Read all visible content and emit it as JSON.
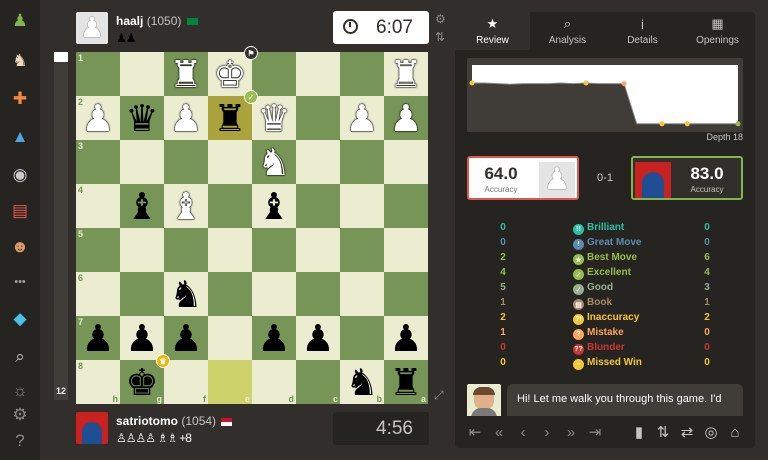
{
  "sidebar": {
    "items": [
      {
        "name": "chess-logo-icon",
        "glyph": "♟",
        "color": "#81b64c"
      },
      {
        "name": "play-icon",
        "glyph": "♞",
        "color": "#f0d9b5"
      },
      {
        "name": "puzzles-icon",
        "glyph": "✚",
        "color": "#f18a3b"
      },
      {
        "name": "learn-icon",
        "glyph": "▲",
        "color": "#4fa3e0"
      },
      {
        "name": "watch-icon",
        "glyph": "◉",
        "color": "#c9c9c9"
      },
      {
        "name": "news-icon",
        "glyph": "▤",
        "color": "#e0574f"
      },
      {
        "name": "social-icon",
        "glyph": "☻",
        "color": "#e09b6a"
      },
      {
        "name": "more-icon",
        "glyph": "•••",
        "color": "#9e9e9e"
      },
      {
        "name": "premium-diamond-icon",
        "glyph": "◆",
        "color": "#48c2e8"
      },
      {
        "name": "search-icon",
        "glyph": "⌕",
        "color": "#c6c4c2"
      },
      {
        "name": "theme-icon",
        "glyph": "☼",
        "color": "#8b8987"
      },
      {
        "name": "settings-gear-icon",
        "glyph": "⚙",
        "color": "#8b8987"
      },
      {
        "name": "help-icon",
        "glyph": "?",
        "color": "#8b8987"
      }
    ]
  },
  "top_player": {
    "name": "haalj",
    "rating": "(1050)",
    "flag": "Saudi Arabia",
    "flag_color": "#00853f",
    "captured": "♟♟"
  },
  "bottom_player": {
    "name": "satriotomo",
    "rating": "(1054)",
    "flag": "Indonesia",
    "captured": "♙♙♙♙ ♗♗ +8"
  },
  "top_clock": "6:07",
  "bottom_clock": "4:56",
  "eval_bar": {
    "value": "12",
    "white_fraction": 0.03
  },
  "board": {
    "light": "#ebecd0",
    "dark": "#779556",
    "ranks": [
      "1",
      "2",
      "3",
      "4",
      "5",
      "6",
      "7",
      "8"
    ],
    "files": [
      "h",
      "g",
      "f",
      "e",
      "d",
      "c",
      "b",
      "a"
    ],
    "pieces": [
      {
        "sq": "f1",
        "glyph": "♜",
        "side": "w"
      },
      {
        "sq": "e1",
        "glyph": "♚",
        "side": "w"
      },
      {
        "sq": "a1",
        "glyph": "♜",
        "side": "w"
      },
      {
        "sq": "h2",
        "glyph": "♟",
        "side": "w"
      },
      {
        "sq": "g2",
        "glyph": "♛",
        "side": "b"
      },
      {
        "sq": "f2",
        "glyph": "♟",
        "side": "w"
      },
      {
        "sq": "e2",
        "glyph": "♜",
        "side": "b"
      },
      {
        "sq": "d2",
        "glyph": "♛",
        "side": "w"
      },
      {
        "sq": "b2",
        "glyph": "♟",
        "side": "w"
      },
      {
        "sq": "a2",
        "glyph": "♟",
        "side": "w"
      },
      {
        "sq": "d3",
        "glyph": "♞",
        "side": "w"
      },
      {
        "sq": "g4",
        "glyph": "♝",
        "side": "b"
      },
      {
        "sq": "f4",
        "glyph": "♝",
        "side": "w"
      },
      {
        "sq": "d4",
        "glyph": "♝",
        "side": "b"
      },
      {
        "sq": "f6",
        "glyph": "♞",
        "side": "b"
      },
      {
        "sq": "h7",
        "glyph": "♟",
        "side": "b"
      },
      {
        "sq": "g7",
        "glyph": "♟",
        "side": "b"
      },
      {
        "sq": "f7",
        "glyph": "♟",
        "side": "b"
      },
      {
        "sq": "d7",
        "glyph": "♟",
        "side": "b"
      },
      {
        "sq": "c7",
        "glyph": "♟",
        "side": "b"
      },
      {
        "sq": "a7",
        "glyph": "♟",
        "side": "b"
      },
      {
        "sq": "g8",
        "glyph": "♚",
        "side": "b"
      },
      {
        "sq": "b8",
        "glyph": "♞",
        "side": "b"
      },
      {
        "sq": "a8",
        "glyph": "♜",
        "side": "b"
      }
    ],
    "move_from": "e8",
    "move_to": "e2",
    "badges": [
      {
        "sq": "e1",
        "glyph": "⚑",
        "bg": "#312e2b",
        "name": "resign-flag-icon"
      },
      {
        "sq": "e2",
        "glyph": "✓",
        "bg": "#96bc4b",
        "name": "good-move-icon"
      },
      {
        "sq": "g8",
        "glyph": "♛",
        "bg": "#f6b501",
        "name": "winner-crown-icon"
      }
    ]
  },
  "tabs": [
    {
      "label": "Review",
      "icon": "★",
      "active": true
    },
    {
      "label": "Analysis",
      "icon": "⌕",
      "active": false
    },
    {
      "label": "Details",
      "icon": "i",
      "active": false
    },
    {
      "label": "Openings",
      "icon": "▦",
      "active": false
    }
  ],
  "depth": "Depth 18",
  "accuracy": {
    "white": {
      "value": "64.0",
      "label": "Accuracy",
      "border": "#e0574f"
    },
    "black": {
      "value": "83.0",
      "label": "Accuracy",
      "border": "#81b64c"
    },
    "result": "0-1"
  },
  "classifications": [
    {
      "name": "Brilliant",
      "white": "0",
      "black": "0",
      "color": "#26c2a3",
      "icon": "!!"
    },
    {
      "name": "Great Move",
      "white": "0",
      "black": "0",
      "color": "#5c8bb0",
      "icon": "!"
    },
    {
      "name": "Best Move",
      "white": "2",
      "black": "6",
      "color": "#96bc4b",
      "icon": "★"
    },
    {
      "name": "Excellent",
      "white": "4",
      "black": "4",
      "color": "#96bc4b",
      "icon": "✓"
    },
    {
      "name": "Good",
      "white": "5",
      "black": "3",
      "color": "#97af8b",
      "icon": "✓"
    },
    {
      "name": "Book",
      "white": "1",
      "black": "1",
      "color": "#a88865",
      "icon": "▤"
    },
    {
      "name": "Inaccuracy",
      "white": "2",
      "black": "2",
      "color": "#f7c631",
      "icon": "?!"
    },
    {
      "name": "Mistake",
      "white": "1",
      "black": "0",
      "color": "#ffa459",
      "icon": "?"
    },
    {
      "name": "Blunder",
      "white": "0",
      "black": "0",
      "color": "#ca3431",
      "icon": "??"
    },
    {
      "name": "Missed Win",
      "white": "0",
      "black": "0",
      "color": "#f7c631",
      "icon": "–"
    }
  ],
  "coach_message": "Hi! Let me walk you through this game. I'd",
  "navbar": {
    "left": [
      "⇤",
      "«",
      "‹",
      "›",
      "»",
      "⇥"
    ],
    "right": [
      "▮",
      "⇅",
      "⇄",
      "◎",
      "⌂"
    ]
  },
  "graph": {
    "advantage": [
      0.3,
      0.3,
      0.31,
      0.32,
      0.31,
      0.31,
      0.31,
      0.3,
      0.31,
      0.3,
      0.31,
      0.31,
      0.31,
      0.98,
      0.98,
      0.98,
      0.98,
      0.98,
      0.98,
      0.98,
      0.98,
      0.98
    ],
    "markers": [
      {
        "move": 0,
        "color": "#f7c631"
      },
      {
        "move": 9,
        "color": "#f7c631"
      },
      {
        "move": 12,
        "color": "#ffa459"
      },
      {
        "move": 15,
        "color": "#f7c631"
      },
      {
        "move": 17,
        "color": "#f7c631"
      },
      {
        "move": 21,
        "color": "#96bc4b"
      }
    ]
  }
}
